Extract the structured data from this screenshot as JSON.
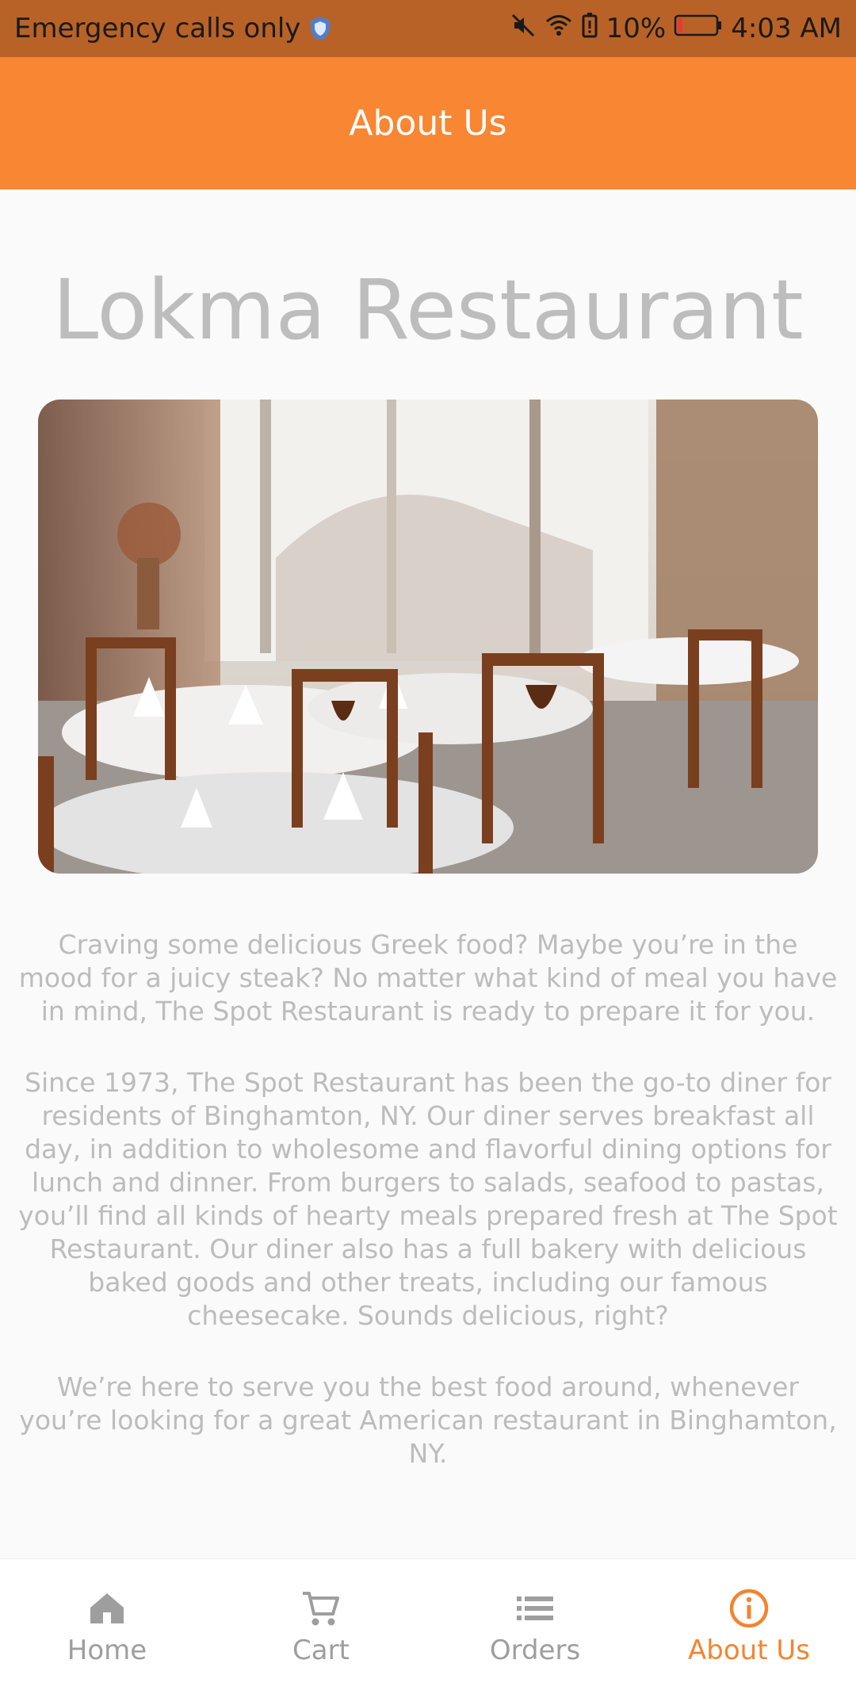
{
  "status_bar": {
    "carrier": "Emergency calls only",
    "battery": "10%",
    "time": "4:03 AM"
  },
  "app_bar": {
    "title": "About Us"
  },
  "main": {
    "restaurant_name": "Lokma Restaurant",
    "paragraphs": [
      "Craving some delicious Greek food? Maybe you’re in the mood for a juicy steak? No matter what kind of meal you have in mind, The Spot Restaurant is ready to prepare it for you.",
      "Since 1973, The Spot Restaurant has been the go-to diner for residents of Binghamton, NY. Our diner serves breakfast all day, in addition to wholesome and flavorful dining options for lunch and dinner. From burgers to salads, seafood to pastas, you’ll find all kinds of hearty meals prepared fresh at The Spot Restaurant. Our diner also has a full bakery with delicious baked goods and other treats, including our famous cheesecake. Sounds delicious, right?",
      "We’re here to serve you the best food around, whenever you’re looking for a great American restaurant in Binghamton, NY."
    ]
  },
  "bottom_nav": {
    "items": [
      {
        "label": "Home",
        "icon": "home-icon"
      },
      {
        "label": "Cart",
        "icon": "cart-icon"
      },
      {
        "label": "Orders",
        "icon": "list-icon"
      },
      {
        "label": "About Us",
        "icon": "info-icon"
      }
    ],
    "active_label": "About Us"
  },
  "colors": {
    "accent": "#f88632",
    "status_bar": "#b96227",
    "active_nav": "#f2852f",
    "inactive_nav": "#9e9e9e"
  }
}
